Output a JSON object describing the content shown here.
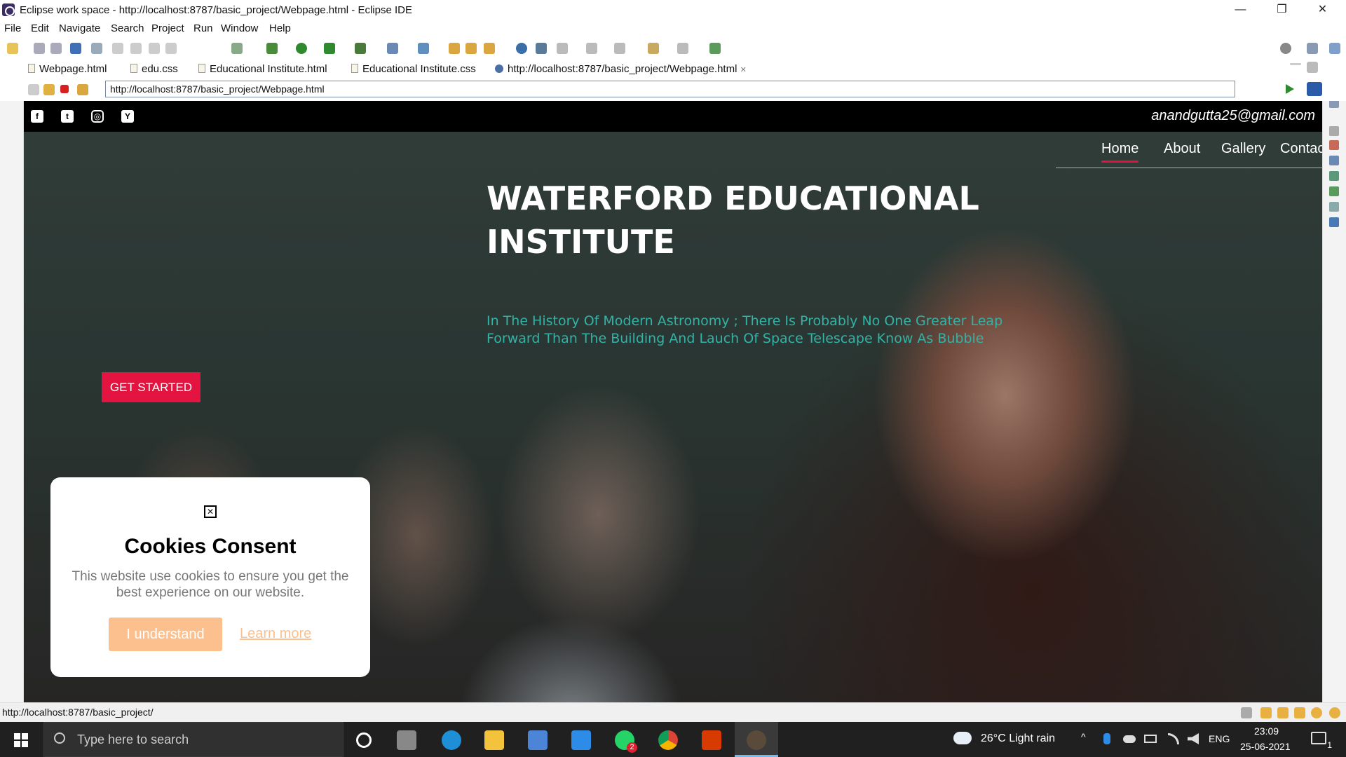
{
  "window": {
    "title": "Eclipse work space - http://localhost:8787/basic_project/Webpage.html - Eclipse IDE",
    "minimize": "—",
    "restore": "❐",
    "close": "✕"
  },
  "menu": [
    "File",
    "Edit",
    "Navigate",
    "Search",
    "Project",
    "Run",
    "Window",
    "Help"
  ],
  "tabs": [
    {
      "label": "Webpage.html"
    },
    {
      "label": "edu.css"
    },
    {
      "label": "Educational Institute.html"
    },
    {
      "label": "Educational Institute.css"
    },
    {
      "label": "http://localhost:8787/basic_project/Webpage.html",
      "close": "✕"
    }
  ],
  "address": {
    "url": "http://localhost:8787/basic_project/Webpage.html"
  },
  "site": {
    "social": [
      "f",
      "t",
      "◎",
      "Y"
    ],
    "email": "anandgutta25@gmail.com",
    "nav": [
      "Home",
      "About",
      "Gallery",
      "Contact"
    ],
    "title": "WATERFORD EDUCATIONAL INSTITUTE",
    "tagline": "In The History Of Modern Astronomy ; There Is Probably No One Greater Leap Forward Than The Building And Lauch Of Space Telescape Know As Bubble",
    "cta": "GET STARTED",
    "accent": "#e3143f",
    "tagline_color": "#33b3a6"
  },
  "cookie": {
    "close": "✕",
    "title": "Cookies Consent",
    "text": "This website use cookies to ensure you get the best experience on our website.",
    "accept": "I understand",
    "learn": "Learn more",
    "accent": "#fcc08e"
  },
  "status": {
    "url": "http://localhost:8787/basic_project/"
  },
  "taskbar": {
    "search_placeholder": "Type here to search",
    "weather": "26°C  Light rain",
    "lang": "ENG",
    "time": "23:09",
    "date": "25-06-2021",
    "whatsapp_badge": "2",
    "notification_count": "1"
  }
}
